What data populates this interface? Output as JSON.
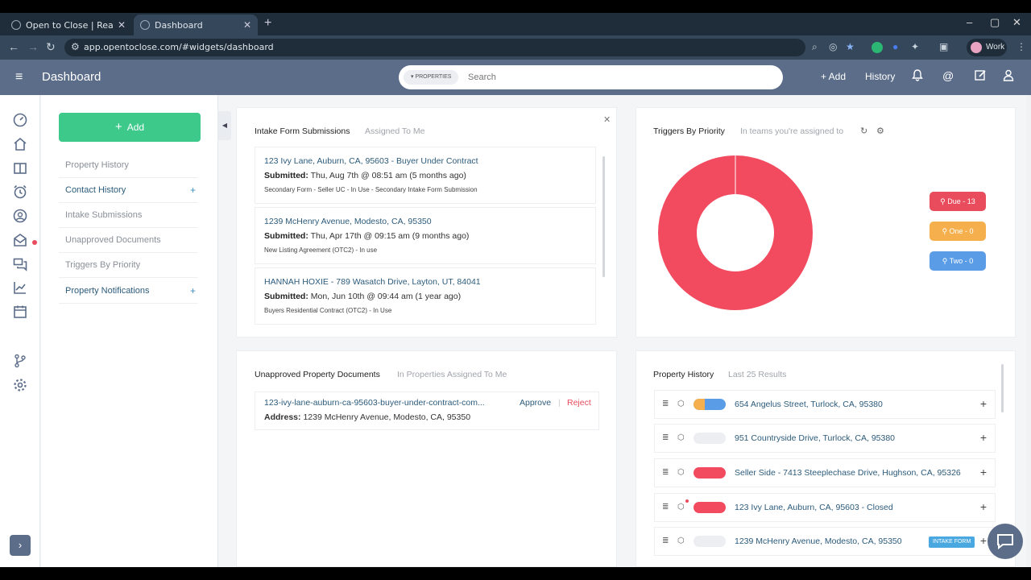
{
  "browser": {
    "tabs": [
      {
        "label": "Open to Close | Real Estate Tra"
      },
      {
        "label": "Dashboard"
      }
    ],
    "url": "app.opentoclose.com/#widgets/dashboard",
    "profile": "Work"
  },
  "header": {
    "title": "Dashboard",
    "search_scope": "▾ PROPERTIES",
    "search_placeholder": "Search",
    "add_label": "+ Add",
    "history_label": "History"
  },
  "leftnav": {
    "add_label": "Add",
    "items": [
      {
        "label": "Property History",
        "link": false
      },
      {
        "label": "Contact History",
        "link": true
      },
      {
        "label": "Intake Submissions",
        "link": false
      },
      {
        "label": "Unapproved Documents",
        "link": false
      },
      {
        "label": "Triggers By Priority",
        "link": false
      },
      {
        "label": "Property Notifications",
        "link": true
      }
    ]
  },
  "intake": {
    "title": "Intake Form Submissions",
    "subtitle": "Assigned To Me",
    "items": [
      {
        "title": "123 Ivy Lane, Auburn, CA, 95603 - Buyer Under Contract",
        "submitted_label": "Submitted:",
        "submitted": "Thu, Aug 7th @ 08:51 am (5 months ago)",
        "detail": "Secondary Form - Seller UC - In Use - Secondary Intake Form Submission"
      },
      {
        "title": "1239 McHenry Avenue, Modesto, CA, 95350",
        "submitted_label": "Submitted:",
        "submitted": "Thu, Apr 17th @ 09:15 am (9 months ago)",
        "detail": "New Listing Agreement (OTC2) - In use"
      },
      {
        "title": "HANNAH HOXIE - 789 Wasatch Drive, Layton, UT, 84041",
        "submitted_label": "Submitted:",
        "submitted": "Mon, Jun 10th @ 09:44 am (1 year ago)",
        "detail": "Buyers Residential Contract (OTC2) - In Use"
      }
    ]
  },
  "triggers": {
    "title": "Triggers By Priority",
    "subtitle": "In teams you're assigned to",
    "badges": [
      {
        "label": "Due - 13",
        "color": "#e84c5d"
      },
      {
        "label": "One - 0",
        "color": "#f5b04d"
      },
      {
        "label": "Two - 0",
        "color": "#5a9de6"
      }
    ],
    "donut_color": "#f24a5f"
  },
  "documents": {
    "title": "Unapproved Property Documents",
    "subtitle": "In Properties Assigned To Me",
    "filename": "123-ivy-lane-auburn-ca-95603-buyer-under-contract-com...",
    "address_label": "Address:",
    "address": "1239 McHenry Avenue, Modesto, CA, 95350",
    "approve": "Approve",
    "separator": "|",
    "reject": "Reject"
  },
  "property_history": {
    "title": "Property History",
    "subtitle": "Last 25 Results",
    "rows": [
      {
        "address": "654 Angelus Street, Turlock, CA, 95380"
      },
      {
        "address": "951 Countryside Drive, Turlock, CA, 95380"
      },
      {
        "address": "Seller Side - 7413 Steeplechase Drive, Hughson, CA, 95326"
      },
      {
        "address": "123 Ivy Lane, Auburn, CA, 95603 - Closed"
      },
      {
        "address": "1239 McHenry Avenue, Modesto, CA, 95350",
        "tag": "INTAKE FORM"
      }
    ]
  }
}
